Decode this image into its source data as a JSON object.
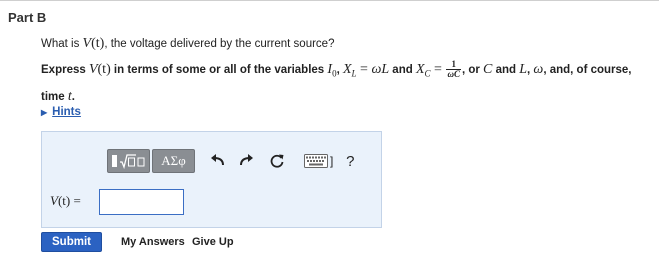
{
  "part": {
    "title": "Part B"
  },
  "question": {
    "prefix": "What is ",
    "var_v": "V",
    "var_arg": "(t)",
    "suffix": ", the voltage delivered by the current source?"
  },
  "instruction": {
    "t1": "Express ",
    "v": "V",
    "varg": "(t)",
    "t2": " in terms of some or all of the variables ",
    "i0": "I",
    "i0sub": "0",
    "t3": ", ",
    "xl": "X",
    "xlsub": "L",
    "eq1": " = ",
    "wl": "ωL",
    "t4": " and ",
    "xc": "X",
    "xcsub": "C",
    "eq2": " = ",
    "frac_num": "1",
    "frac_den": "ωC",
    "t5": ", or ",
    "c": "C",
    "t6": " and ",
    "l": "L",
    "t7": ", ",
    "w": "ω",
    "t8": ", and, of course, time ",
    "t": "t",
    "t9": "."
  },
  "hints": {
    "label": "Hints"
  },
  "toolbar": {
    "templates_label": "▮√▢",
    "symbols_label": "ΑΣφ",
    "undo_icon": "undo-arrow",
    "redo_icon": "redo-arrow",
    "reset_icon": "reset-circle",
    "keyboard_icon": "keyboard",
    "help_label": "?"
  },
  "answer": {
    "var": "V",
    "arg": "(t)",
    "equals": " =",
    "value": ""
  },
  "actions": {
    "submit": "Submit",
    "my_answers": "My Answers",
    "give_up": "Give Up"
  }
}
